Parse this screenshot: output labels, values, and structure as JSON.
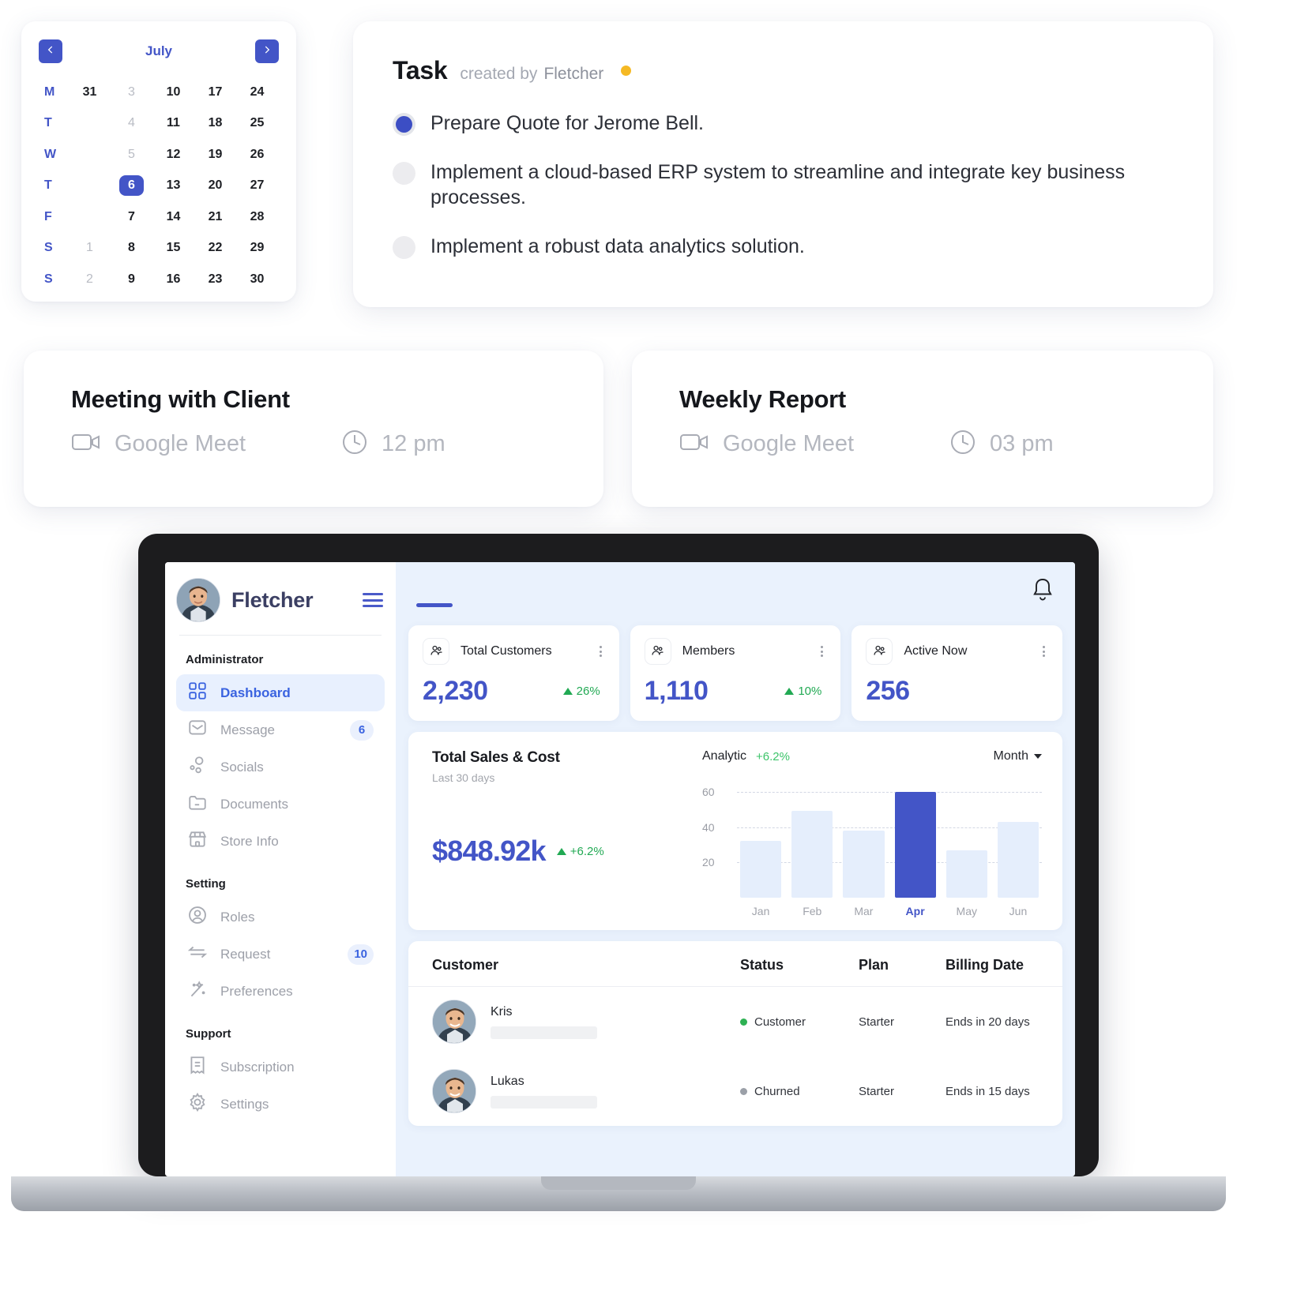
{
  "calendar": {
    "month": "July",
    "prev_icon": "chevron-left-icon",
    "next_icon": "chevron-right-icon",
    "rows": [
      {
        "dow": "M",
        "cells": [
          {
            "t": "31",
            "s": "normal"
          },
          {
            "t": "3",
            "s": "muted"
          },
          {
            "t": "10",
            "s": "normal"
          },
          {
            "t": "17",
            "s": "normal"
          },
          {
            "t": "24",
            "s": "normal"
          }
        ]
      },
      {
        "dow": "T",
        "cells": [
          {
            "t": "",
            "s": "empty"
          },
          {
            "t": "4",
            "s": "muted"
          },
          {
            "t": "11",
            "s": "normal"
          },
          {
            "t": "18",
            "s": "normal"
          },
          {
            "t": "25",
            "s": "normal"
          }
        ]
      },
      {
        "dow": "W",
        "cells": [
          {
            "t": "",
            "s": "empty"
          },
          {
            "t": "5",
            "s": "muted"
          },
          {
            "t": "12",
            "s": "normal"
          },
          {
            "t": "19",
            "s": "normal"
          },
          {
            "t": "26",
            "s": "normal"
          }
        ]
      },
      {
        "dow": "T",
        "cells": [
          {
            "t": "",
            "s": "empty"
          },
          {
            "t": "6",
            "s": "selected"
          },
          {
            "t": "13",
            "s": "normal"
          },
          {
            "t": "20",
            "s": "normal"
          },
          {
            "t": "27",
            "s": "normal"
          }
        ]
      },
      {
        "dow": "F",
        "cells": [
          {
            "t": "",
            "s": "empty"
          },
          {
            "t": "7",
            "s": "normal"
          },
          {
            "t": "14",
            "s": "normal"
          },
          {
            "t": "21",
            "s": "normal"
          },
          {
            "t": "28",
            "s": "normal"
          }
        ]
      },
      {
        "dow": "S",
        "cells": [
          {
            "t": "1",
            "s": "muted"
          },
          {
            "t": "8",
            "s": "normal"
          },
          {
            "t": "15",
            "s": "normal"
          },
          {
            "t": "22",
            "s": "normal"
          },
          {
            "t": "29",
            "s": "normal"
          }
        ]
      },
      {
        "dow": "S",
        "cells": [
          {
            "t": "2",
            "s": "muted"
          },
          {
            "t": "9",
            "s": "normal"
          },
          {
            "t": "16",
            "s": "normal"
          },
          {
            "t": "23",
            "s": "normal"
          },
          {
            "t": "30",
            "s": "normal"
          }
        ]
      }
    ]
  },
  "task": {
    "title": "Task",
    "created_by_label": "created by",
    "creator": "Fletcher",
    "status_dot_color": "#f5b924",
    "items": [
      {
        "text": "Prepare Quote for Jerome Bell.",
        "checked": true
      },
      {
        "text": "Implement a cloud-based ERP system to streamline and integrate key business processes.",
        "checked": false
      },
      {
        "text": "Implement a robust data analytics solution.",
        "checked": false
      }
    ]
  },
  "meetings": [
    {
      "title": "Meeting with Client",
      "platform": "Google Meet",
      "platform_icon": "video-camera-icon",
      "time": "12 pm",
      "time_icon": "clock-icon"
    },
    {
      "title": "Weekly Report",
      "platform": "Google Meet",
      "platform_icon": "video-camera-icon",
      "time": "03 pm",
      "time_icon": "clock-icon"
    }
  ],
  "dashboard": {
    "sidebar": {
      "user_name": "Fletcher",
      "menu_icon": "hamburger-menu-icon",
      "sections": [
        {
          "title": "Administrator",
          "items": [
            {
              "label": "Dashboard",
              "icon": "grid-dashboard-icon",
              "badge": "",
              "active": true
            },
            {
              "label": "Message",
              "icon": "message-icon",
              "badge": "6",
              "active": false
            },
            {
              "label": "Socials",
              "icon": "socials-icon",
              "badge": "",
              "active": false
            },
            {
              "label": "Documents",
              "icon": "folder-icon",
              "badge": "",
              "active": false
            },
            {
              "label": "Store Info",
              "icon": "store-icon",
              "badge": "",
              "active": false
            }
          ]
        },
        {
          "title": "Setting",
          "items": [
            {
              "label": "Roles",
              "icon": "user-circle-icon",
              "badge": "",
              "active": false
            },
            {
              "label": "Request",
              "icon": "transfer-arrows-icon",
              "badge": "10",
              "active": false
            },
            {
              "label": "Preferences",
              "icon": "magic-wand-icon",
              "badge": "",
              "active": false
            }
          ]
        },
        {
          "title": "Support",
          "items": [
            {
              "label": "Subscription",
              "icon": "receipt-icon",
              "badge": "",
              "active": false
            },
            {
              "label": "Settings",
              "icon": "gear-icon",
              "badge": "",
              "active": false
            }
          ]
        }
      ]
    },
    "topbar": {
      "notification_icon": "bell-icon"
    },
    "stats": [
      {
        "name": "Total Customers",
        "icon": "users-icon",
        "value": "2,230",
        "delta": "26%",
        "delta_dir": "up",
        "delta_color": "#21a953"
      },
      {
        "name": "Members",
        "icon": "users-icon",
        "value": "1,110",
        "delta": "10%",
        "delta_dir": "up",
        "delta_color": "#21a953"
      },
      {
        "name": "Active Now",
        "icon": "users-icon",
        "value": "256",
        "delta": "",
        "delta_dir": "",
        "delta_color": ""
      }
    ],
    "sales": {
      "title": "Total Sales & Cost",
      "subtitle": "Last 30 days",
      "amount": "$848.92k",
      "delta": "+6.2%",
      "analytic_label": "Analytic",
      "analytic_delta": "+6.2%",
      "period": "Month"
    },
    "table": {
      "columns": [
        "Customer",
        "Status",
        "Plan",
        "Billing Date"
      ],
      "rows": [
        {
          "name": "Kris",
          "status": "Customer",
          "status_color": "#2eb153",
          "plan": "Starter",
          "billing": "Ends in 20 days"
        },
        {
          "name": "Lukas",
          "status": "Churned",
          "status_color": "#9ba0a8",
          "plan": "Starter",
          "billing": "Ends in 15 days"
        }
      ]
    }
  },
  "chart_data": {
    "type": "bar",
    "title": "Analytic",
    "categories": [
      "Jan",
      "Feb",
      "Mar",
      "Apr",
      "May",
      "Jun"
    ],
    "values": [
      32,
      49,
      38,
      60,
      27,
      43
    ],
    "highlight_index": 3,
    "xlabel": "",
    "ylabel": "",
    "ylim": [
      0,
      68
    ],
    "yticks": [
      20,
      40,
      60
    ],
    "grid": true,
    "legend": "none",
    "bar_color": "#e5eefc",
    "highlight_color": "#4355c7"
  }
}
